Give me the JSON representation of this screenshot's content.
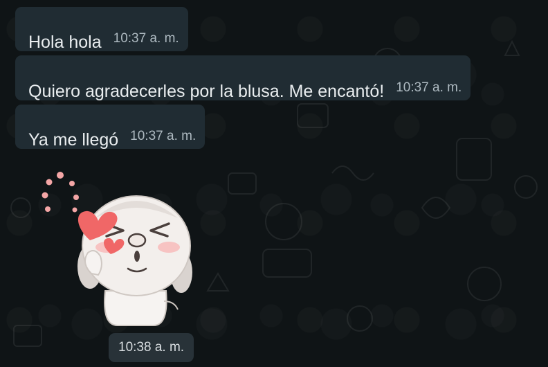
{
  "messages": [
    {
      "text": "Hola hola",
      "time": "10:37 a. m."
    },
    {
      "text": "Quiero agradecerles por la blusa. Me encantó!",
      "time": "10:37 a. m."
    },
    {
      "text": "Ya me llegó",
      "time": "10:37 a. m."
    }
  ],
  "sticker": {
    "icon": "bunny-blushing-hearts-sticker",
    "time": "10:38 a. m."
  },
  "colors": {
    "background": "#0f1416",
    "bubble": "#202c33",
    "text": "#e9edef",
    "timestamp": "#aebac1",
    "heart": "#f06767"
  }
}
